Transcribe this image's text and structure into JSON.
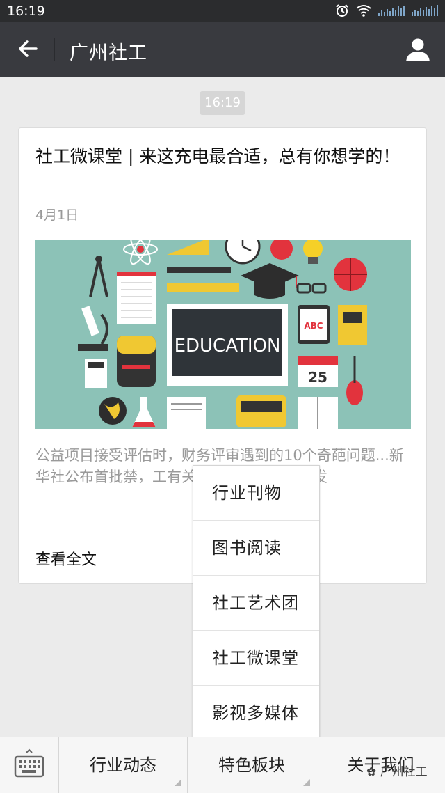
{
  "status_bar": {
    "time": "16:19",
    "icons": [
      "alarm-icon",
      "wifi-icon",
      "signal-icon",
      "signal-icon"
    ]
  },
  "header": {
    "title": "广州社工",
    "back_icon": "back-arrow-icon",
    "profile_icon": "person-icon"
  },
  "chat": {
    "timestamp": "16:19",
    "article": {
      "title": "社工微课堂 | 来这充电最合适，总有你想学的！",
      "date": "4月1日",
      "banner_text": "EDUCATION",
      "banner_abc": "ABC",
      "banner_calendar": "25",
      "summary": "公益项目接受评估时，财务评审遇到的10个奇葩问题...新华社公布首批禁，工有关？多少岁长者可获发",
      "read_more": "查看全文"
    }
  },
  "popup_menu": {
    "items": [
      "行业刊物",
      "图书阅读",
      "社工艺术团",
      "社工微课堂",
      "影视多媒体"
    ]
  },
  "bottom_menu": {
    "keyboard_icon": "keyboard-icon",
    "items": [
      "行业动态",
      "特色板块",
      "关于我们"
    ]
  },
  "watermark": "广州社工",
  "colors": {
    "nav_bg": "#393a3f",
    "status_bg": "#2b2c2e",
    "chat_bg": "#ebebeb",
    "banner_bg": "#8cc2b7"
  }
}
